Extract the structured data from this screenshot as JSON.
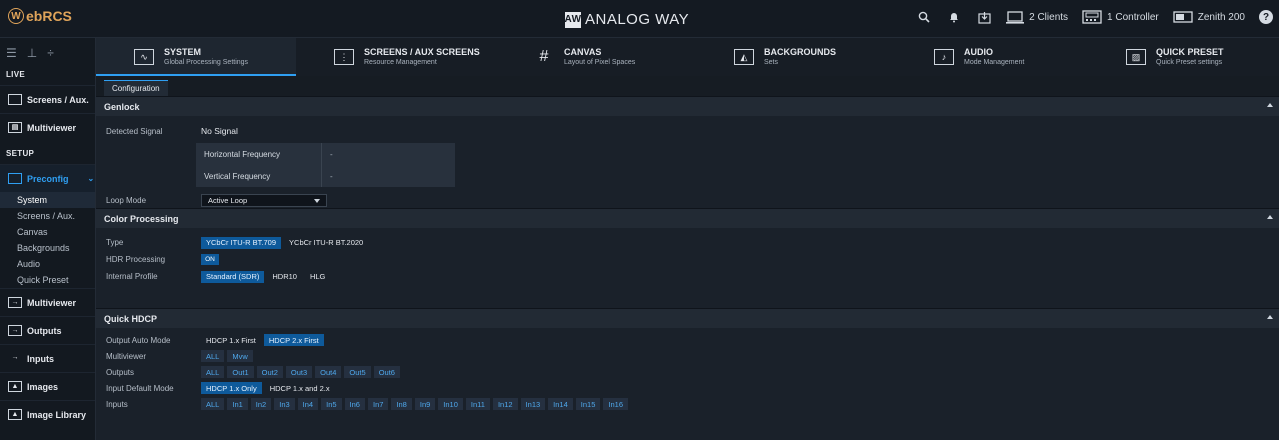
{
  "app": {
    "logo_letter": "W",
    "logo_text": "ebRCS"
  },
  "brand": {
    "box": "AW",
    "text": "ANALOG WAY"
  },
  "top_right": {
    "clients": "2 Clients",
    "controllers": "1 Controller",
    "device": "Zenith 200"
  },
  "sidebar": {
    "live_label": "LIVE",
    "setup_label": "SETUP",
    "items": [
      {
        "label": "Screens / Aux."
      },
      {
        "label": "Multiviewer"
      },
      {
        "label": "Preconfig"
      },
      {
        "label": "Multiviewer"
      },
      {
        "label": "Outputs"
      },
      {
        "label": "Inputs"
      },
      {
        "label": "Images"
      },
      {
        "label": "Image Library"
      }
    ],
    "subs": [
      "System",
      "Screens / Aux.",
      "Canvas",
      "Backgrounds",
      "Audio",
      "Quick Preset"
    ]
  },
  "tabs": [
    {
      "title": "SYSTEM",
      "sub": "Global Processing Settings"
    },
    {
      "title": "SCREENS / AUX SCREENS",
      "sub": "Resource Management"
    },
    {
      "title": "CANVAS",
      "sub": "Layout of Pixel Spaces"
    },
    {
      "title": "BACKGROUNDS",
      "sub": "Sets"
    },
    {
      "title": "AUDIO",
      "sub": "Mode Management"
    },
    {
      "title": "QUICK PRESET",
      "sub": "Quick Preset settings"
    }
  ],
  "subtab": "Configuration",
  "genlock": {
    "title": "Genlock",
    "detected_label": "Detected Signal",
    "detected_value": "No Signal",
    "hfreq_label": "Horizontal Frequency",
    "hfreq_value": "-",
    "vfreq_label": "Vertical Frequency",
    "vfreq_value": "-",
    "loop_label": "Loop Mode",
    "loop_value": "Active Loop"
  },
  "color": {
    "title": "Color Processing",
    "type_label": "Type",
    "type_opts": [
      "YCbCr ITU-R BT.709",
      "YCbCr ITU-R BT.2020"
    ],
    "hdr_label": "HDR Processing",
    "hdr_value": "ON",
    "profile_label": "Internal Profile",
    "profile_opts": [
      "Standard (SDR)",
      "HDR10",
      "HLG"
    ]
  },
  "hdcp": {
    "title": "Quick HDCP",
    "out_auto_label": "Output Auto Mode",
    "out_auto_opts": [
      "HDCP 1.x First",
      "HDCP 2.x First"
    ],
    "mv_label": "Multiviewer",
    "mv_opts": [
      "ALL",
      "Mvw"
    ],
    "outputs_label": "Outputs",
    "outputs_opts": [
      "ALL",
      "Out1",
      "Out2",
      "Out3",
      "Out4",
      "Out5",
      "Out6"
    ],
    "in_default_label": "Input Default Mode",
    "in_default_opts": [
      "HDCP 1.x Only",
      "HDCP 1.x and 2.x"
    ],
    "inputs_label": "Inputs",
    "inputs_opts": [
      "ALL",
      "In1",
      "In2",
      "In3",
      "In4",
      "In5",
      "In6",
      "In7",
      "In8",
      "In9",
      "In10",
      "In11",
      "In12",
      "In13",
      "In14",
      "In15",
      "In16"
    ]
  }
}
